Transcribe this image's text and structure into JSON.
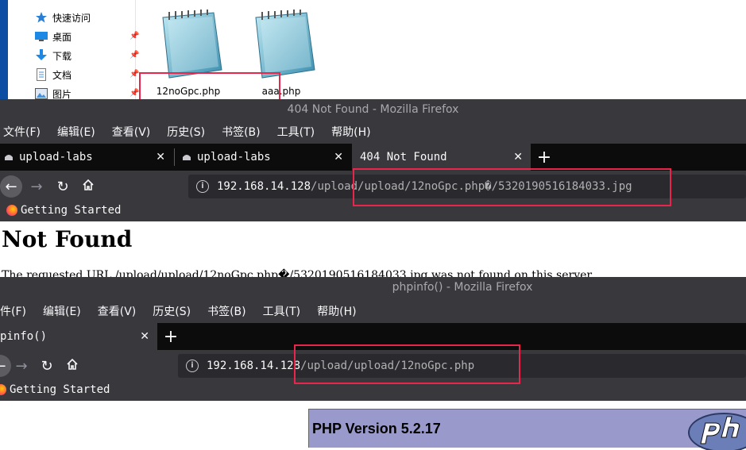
{
  "explorer": {
    "nav": [
      {
        "label": "快速访问",
        "icon": "star-icon"
      },
      {
        "label": "桌面",
        "icon": "desktop-icon"
      },
      {
        "label": "下载",
        "icon": "download-icon"
      },
      {
        "label": "文档",
        "icon": "document-icon"
      },
      {
        "label": "图片",
        "icon": "pictures-icon"
      }
    ],
    "files": [
      {
        "name": "12noGpc.php",
        "icon": "notepad-icon"
      },
      {
        "name": "aaa.php",
        "icon": "notepad-icon"
      }
    ]
  },
  "window1": {
    "title": "404 Not Found - Mozilla Firefox",
    "menu": [
      "文件(F)",
      "编辑(E)",
      "查看(V)",
      "历史(S)",
      "书签(B)",
      "工具(T)",
      "帮助(H)"
    ],
    "tabs": [
      {
        "label": "upload-labs",
        "active": false
      },
      {
        "label": "upload-labs",
        "active": false
      },
      {
        "label": "404 Not Found",
        "active": true
      }
    ],
    "url": {
      "host": "192.168.14.128",
      "path": "/upload/upload/12noGpc.php�/5320190516184033.jpg"
    },
    "bookmark": "Getting Started",
    "page": {
      "heading": "Not Found",
      "text": "The requested URL /upload/upload/12noGpc.php�/5320190516184033.jpg was not found on this server."
    }
  },
  "window2": {
    "title": "phpinfo() - Mozilla Firefox",
    "menu": [
      "件(F)",
      "编辑(E)",
      "查看(V)",
      "历史(S)",
      "书签(B)",
      "工具(T)",
      "帮助(H)"
    ],
    "tabs": [
      {
        "label": "pinfo()",
        "active": true
      }
    ],
    "url": {
      "host": "192.168.14.128",
      "path": "/upload/upload/12noGpc.php"
    },
    "bookmark": "Getting Started",
    "page": {
      "php_version": "PHP Version 5.2.17"
    }
  },
  "colors": {
    "highlight": "#e8264b",
    "firefox_dark": "#38383d",
    "tabstrip": "#0c0c0d",
    "php_header": "#9999cc"
  }
}
